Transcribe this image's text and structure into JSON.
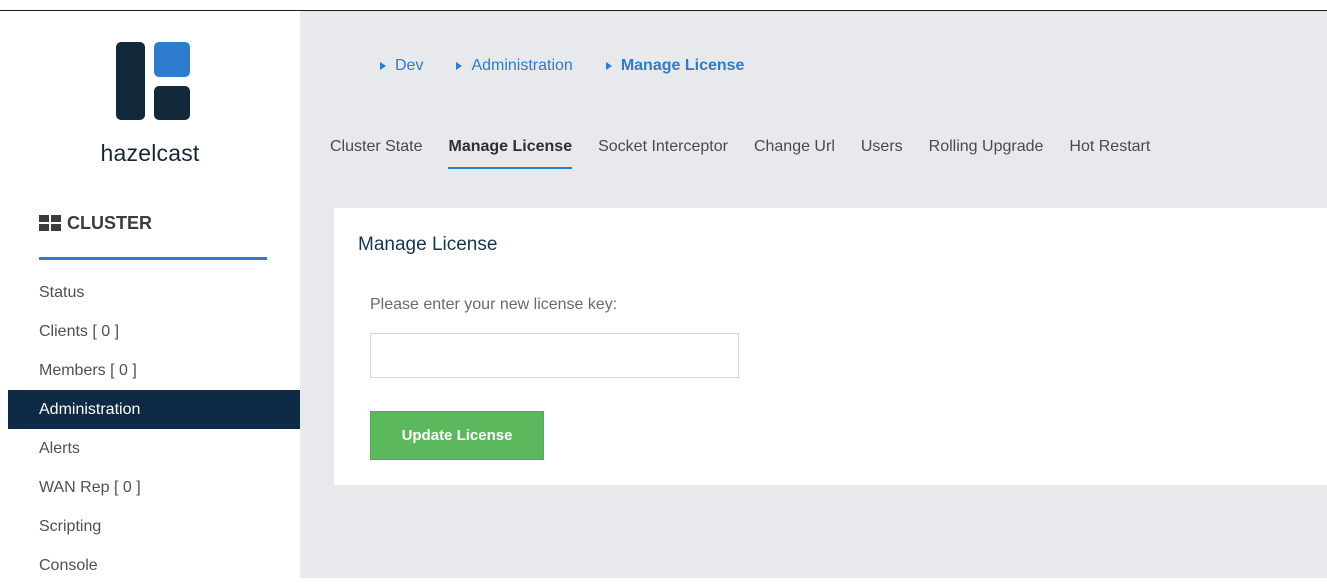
{
  "brand": {
    "name": "hazelcast",
    "logo_icon": "hazelcast-logo-icon",
    "colors": {
      "dark": "#12293a",
      "blue": "#2d7ccf"
    }
  },
  "sidebar": {
    "section_icon": "grid-icon",
    "section_title": "CLUSTER",
    "items": [
      {
        "label": "Status"
      },
      {
        "label": "Clients [ 0 ]"
      },
      {
        "label": "Members [ 0 ]"
      },
      {
        "label": "Administration"
      },
      {
        "label": "Alerts"
      },
      {
        "label": "WAN Rep [ 0 ]"
      },
      {
        "label": "Scripting"
      },
      {
        "label": "Console"
      }
    ],
    "active_label": "Administration"
  },
  "breadcrumb": [
    {
      "label": "Dev"
    },
    {
      "label": "Administration"
    },
    {
      "label": "Manage License"
    }
  ],
  "tabs": [
    {
      "label": "Cluster State"
    },
    {
      "label": "Manage License"
    },
    {
      "label": "Socket Interceptor"
    },
    {
      "label": "Change Url"
    },
    {
      "label": "Users"
    },
    {
      "label": "Rolling Upgrade"
    },
    {
      "label": "Hot Restart"
    }
  ],
  "active_tab": "Manage License",
  "panel": {
    "title": "Manage License",
    "field_label": "Please enter your new license key:",
    "input_value": "",
    "input_placeholder": "",
    "button_label": "Update License",
    "button_color": "#5cb85c"
  }
}
